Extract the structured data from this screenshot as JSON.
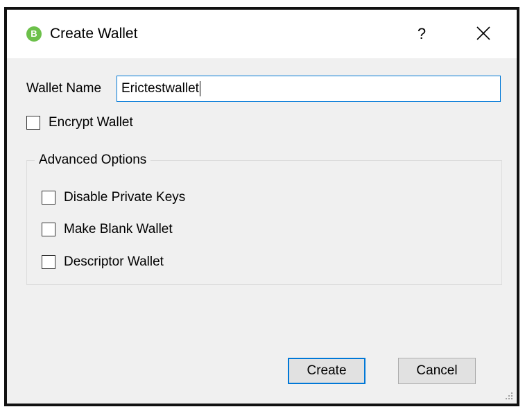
{
  "window": {
    "title": "Create Wallet",
    "app_icon_glyph": "B",
    "help_label": "?",
    "accent_color": "#0078d7",
    "icon_color": "#6cc04a"
  },
  "form": {
    "wallet_name_label": "Wallet Name",
    "wallet_name_value": "Erictestwallet",
    "encrypt_label": "Encrypt Wallet",
    "encrypt_checked": false
  },
  "advanced": {
    "title": "Advanced Options",
    "options": [
      {
        "label": "Disable Private Keys",
        "checked": false
      },
      {
        "label": "Make Blank Wallet",
        "checked": false
      },
      {
        "label": "Descriptor Wallet",
        "checked": false
      }
    ]
  },
  "buttons": {
    "create_label": "Create",
    "cancel_label": "Cancel"
  }
}
